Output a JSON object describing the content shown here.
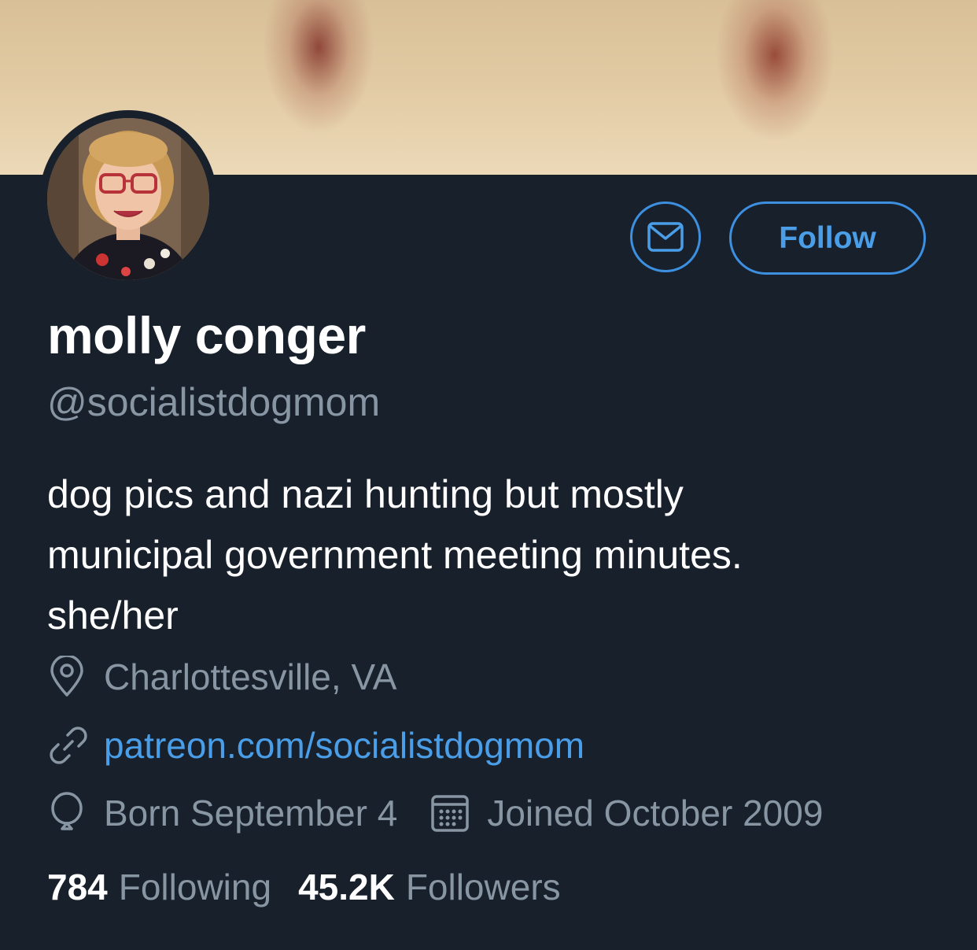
{
  "profile": {
    "name": "molly conger",
    "handle": "@socialistdogmom",
    "bio_lines": [
      "dog pics and nazi hunting but mostly",
      "municipal government meeting minutes.",
      "she/her"
    ],
    "location": "Charlottesville, VA",
    "website": "patreon.com/socialistdogmom",
    "birthday": "Born September 4",
    "joined": "Joined October 2009"
  },
  "actions": {
    "follow_label": "Follow",
    "message_icon": "envelope-icon"
  },
  "stats": {
    "following_count": "784",
    "following_label": "Following",
    "followers_count": "45.2K",
    "followers_label": "Followers"
  },
  "icons": {
    "location": "location-pin-icon",
    "website": "link-icon",
    "birthday": "balloon-icon",
    "joined": "calendar-icon"
  },
  "colors": {
    "background": "#18202c",
    "accent": "#3d8fe0",
    "secondary_text": "#8896a4",
    "primary_text": "#ffffff"
  }
}
